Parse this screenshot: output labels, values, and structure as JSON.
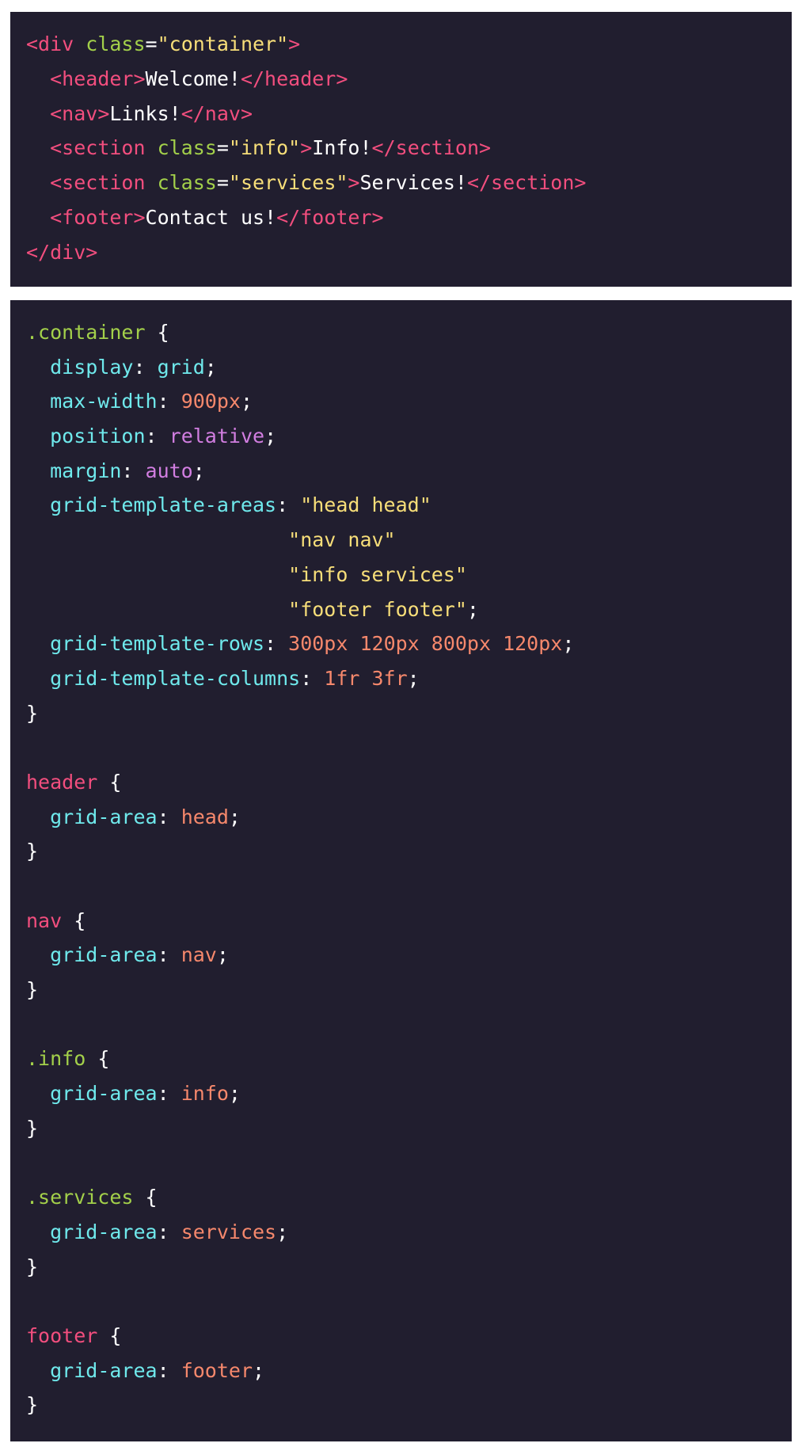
{
  "colors": {
    "background": "#ffffff",
    "code_background": "#211e2f",
    "tag": "#f24e7e",
    "attribute": "#a3d04a",
    "string": "#f7de79",
    "text": "#ffffff",
    "class_selector": "#a3d04a",
    "element_selector": "#f24e7e",
    "property": "#6fe9ec",
    "number": "#f6886c",
    "keyword": "#d27ee1"
  },
  "html_block": {
    "lines": [
      [
        [
          "t-tag",
          "<div "
        ],
        [
          "t-attr",
          "class"
        ],
        [
          "t-punc",
          "="
        ],
        [
          "t-str",
          "\"container\""
        ],
        [
          "t-tag",
          ">"
        ]
      ],
      [
        [
          "t-text",
          "  "
        ],
        [
          "t-tag",
          "<header>"
        ],
        [
          "t-text",
          "Welcome!"
        ],
        [
          "t-tag",
          "</header>"
        ]
      ],
      [
        [
          "t-text",
          "  "
        ],
        [
          "t-tag",
          "<nav>"
        ],
        [
          "t-text",
          "Links!"
        ],
        [
          "t-tag",
          "</nav>"
        ]
      ],
      [
        [
          "t-text",
          "  "
        ],
        [
          "t-tag",
          "<section "
        ],
        [
          "t-attr",
          "class"
        ],
        [
          "t-punc",
          "="
        ],
        [
          "t-str",
          "\"info\""
        ],
        [
          "t-tag",
          ">"
        ],
        [
          "t-text",
          "Info!"
        ],
        [
          "t-tag",
          "</section>"
        ]
      ],
      [
        [
          "t-text",
          "  "
        ],
        [
          "t-tag",
          "<section "
        ],
        [
          "t-attr",
          "class"
        ],
        [
          "t-punc",
          "="
        ],
        [
          "t-str",
          "\"services\""
        ],
        [
          "t-tag",
          ">"
        ],
        [
          "t-text",
          "Services!"
        ],
        [
          "t-tag",
          "</section>"
        ]
      ],
      [
        [
          "t-text",
          "  "
        ],
        [
          "t-tag",
          "<footer>"
        ],
        [
          "t-text",
          "Contact us!"
        ],
        [
          "t-tag",
          "</footer>"
        ]
      ],
      [
        [
          "t-tag",
          "</div>"
        ]
      ]
    ]
  },
  "css_block": {
    "lines": [
      [
        [
          "t-sel",
          ".container"
        ],
        [
          "t-punc",
          " {"
        ]
      ],
      [
        [
          "t-text",
          "  "
        ],
        [
          "t-prop",
          "display"
        ],
        [
          "t-punc",
          ": "
        ],
        [
          "t-prop",
          "grid"
        ],
        [
          "t-punc",
          ";"
        ]
      ],
      [
        [
          "t-text",
          "  "
        ],
        [
          "t-prop",
          "max-width"
        ],
        [
          "t-punc",
          ": "
        ],
        [
          "t-num",
          "900px"
        ],
        [
          "t-punc",
          ";"
        ]
      ],
      [
        [
          "t-text",
          "  "
        ],
        [
          "t-prop",
          "position"
        ],
        [
          "t-punc",
          ": "
        ],
        [
          "t-kw",
          "relative"
        ],
        [
          "t-punc",
          ";"
        ]
      ],
      [
        [
          "t-text",
          "  "
        ],
        [
          "t-prop",
          "margin"
        ],
        [
          "t-punc",
          ": "
        ],
        [
          "t-kw",
          "auto"
        ],
        [
          "t-punc",
          ";"
        ]
      ],
      [
        [
          "t-text",
          "  "
        ],
        [
          "t-prop",
          "grid-template-areas"
        ],
        [
          "t-punc",
          ": "
        ],
        [
          "t-str",
          "\"head head\""
        ]
      ],
      [
        [
          "t-text",
          "                      "
        ],
        [
          "t-str",
          "\"nav nav\""
        ]
      ],
      [
        [
          "t-text",
          "                      "
        ],
        [
          "t-str",
          "\"info services\""
        ]
      ],
      [
        [
          "t-text",
          "                      "
        ],
        [
          "t-str",
          "\"footer footer\""
        ],
        [
          "t-punc",
          ";"
        ]
      ],
      [
        [
          "t-text",
          "  "
        ],
        [
          "t-prop",
          "grid-template-rows"
        ],
        [
          "t-punc",
          ": "
        ],
        [
          "t-num",
          "300px 120px 800px 120px"
        ],
        [
          "t-punc",
          ";"
        ]
      ],
      [
        [
          "t-text",
          "  "
        ],
        [
          "t-prop",
          "grid-template-columns"
        ],
        [
          "t-punc",
          ": "
        ],
        [
          "t-num",
          "1fr 3fr"
        ],
        [
          "t-punc",
          ";"
        ]
      ],
      [
        [
          "t-punc",
          "}"
        ]
      ],
      [
        [
          "t-text",
          ""
        ]
      ],
      [
        [
          "t-elsel",
          "header"
        ],
        [
          "t-punc",
          " {"
        ]
      ],
      [
        [
          "t-text",
          "  "
        ],
        [
          "t-prop",
          "grid-area"
        ],
        [
          "t-punc",
          ": "
        ],
        [
          "t-ident",
          "head"
        ],
        [
          "t-punc",
          ";"
        ]
      ],
      [
        [
          "t-punc",
          "}"
        ]
      ],
      [
        [
          "t-text",
          ""
        ]
      ],
      [
        [
          "t-elsel",
          "nav"
        ],
        [
          "t-punc",
          " {"
        ]
      ],
      [
        [
          "t-text",
          "  "
        ],
        [
          "t-prop",
          "grid-area"
        ],
        [
          "t-punc",
          ": "
        ],
        [
          "t-ident",
          "nav"
        ],
        [
          "t-punc",
          ";"
        ]
      ],
      [
        [
          "t-punc",
          "}"
        ]
      ],
      [
        [
          "t-text",
          ""
        ]
      ],
      [
        [
          "t-sel",
          ".info"
        ],
        [
          "t-punc",
          " {"
        ]
      ],
      [
        [
          "t-text",
          "  "
        ],
        [
          "t-prop",
          "grid-area"
        ],
        [
          "t-punc",
          ": "
        ],
        [
          "t-ident",
          "info"
        ],
        [
          "t-punc",
          ";"
        ]
      ],
      [
        [
          "t-punc",
          "}"
        ]
      ],
      [
        [
          "t-text",
          ""
        ]
      ],
      [
        [
          "t-sel",
          ".services"
        ],
        [
          "t-punc",
          " {"
        ]
      ],
      [
        [
          "t-text",
          "  "
        ],
        [
          "t-prop",
          "grid-area"
        ],
        [
          "t-punc",
          ": "
        ],
        [
          "t-ident",
          "services"
        ],
        [
          "t-punc",
          ";"
        ]
      ],
      [
        [
          "t-punc",
          "}"
        ]
      ],
      [
        [
          "t-text",
          ""
        ]
      ],
      [
        [
          "t-elsel",
          "footer"
        ],
        [
          "t-punc",
          " {"
        ]
      ],
      [
        [
          "t-text",
          "  "
        ],
        [
          "t-prop",
          "grid-area"
        ],
        [
          "t-punc",
          ": "
        ],
        [
          "t-ident",
          "footer"
        ],
        [
          "t-punc",
          ";"
        ]
      ],
      [
        [
          "t-punc",
          "}"
        ]
      ]
    ]
  }
}
